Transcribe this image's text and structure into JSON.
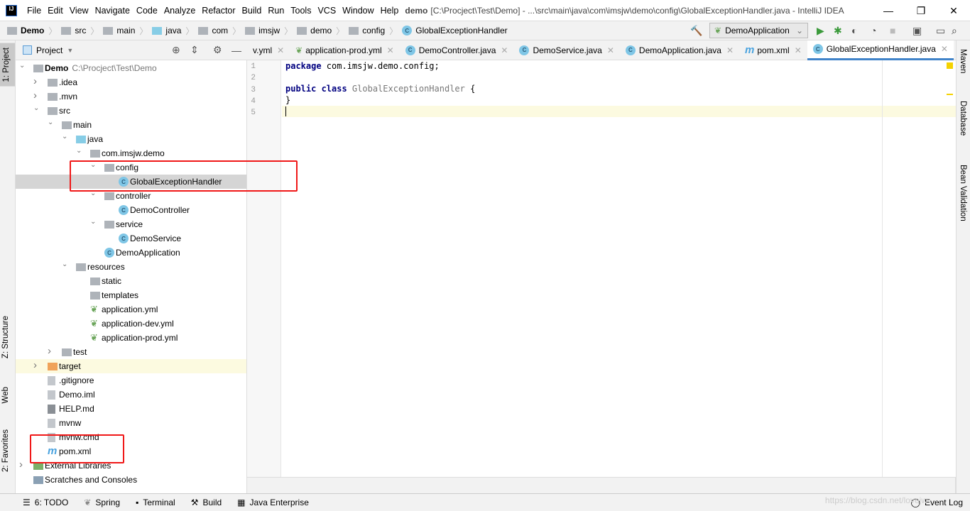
{
  "title_bar": {
    "menu": [
      "File",
      "Edit",
      "View",
      "Navigate",
      "Code",
      "Analyze",
      "Refactor",
      "Build",
      "Run",
      "Tools",
      "VCS",
      "Window",
      "Help"
    ],
    "project": "demo",
    "title": "[C:\\Procject\\Test\\Demo] - ...\\src\\main\\java\\com\\imsjw\\demo\\config\\GlobalExceptionHandler.java - IntelliJ IDEA"
  },
  "breadcrumb": [
    "Demo",
    "src",
    "main",
    "java",
    "com",
    "imsjw",
    "demo",
    "config",
    "GlobalExceptionHandler"
  ],
  "run_config": "DemoApplication",
  "project_panel": {
    "title": "Project"
  },
  "tree": [
    {
      "label": "Demo",
      "path": "C:\\Procject\\Test\\Demo",
      "level": 0,
      "arrow": "down",
      "icon": "module-folder"
    },
    {
      "label": ".idea",
      "level": 1,
      "arrow": "right",
      "icon": "folder"
    },
    {
      "label": ".mvn",
      "level": 1,
      "arrow": "right",
      "icon": "folder"
    },
    {
      "label": "src",
      "level": 1,
      "arrow": "down",
      "icon": "folder"
    },
    {
      "label": "main",
      "level": 2,
      "arrow": "down",
      "icon": "folder"
    },
    {
      "label": "java",
      "level": 3,
      "arrow": "down",
      "icon": "source-folder"
    },
    {
      "label": "com.imsjw.demo",
      "level": 4,
      "arrow": "down",
      "icon": "package"
    },
    {
      "label": "config",
      "level": 5,
      "arrow": "down",
      "icon": "package"
    },
    {
      "label": "GlobalExceptionHandler",
      "level": 6,
      "icon": "class",
      "selected": true
    },
    {
      "label": "controller",
      "level": 5,
      "arrow": "down",
      "icon": "package"
    },
    {
      "label": "DemoController",
      "level": 6,
      "icon": "class"
    },
    {
      "label": "service",
      "level": 5,
      "arrow": "down",
      "icon": "package"
    },
    {
      "label": "DemoService",
      "level": 6,
      "icon": "class"
    },
    {
      "label": "DemoApplication",
      "level": 5,
      "icon": "spring-class"
    },
    {
      "label": "resources",
      "level": 3,
      "arrow": "down",
      "icon": "resources-folder"
    },
    {
      "label": "static",
      "level": 4,
      "icon": "folder"
    },
    {
      "label": "templates",
      "level": 4,
      "icon": "folder"
    },
    {
      "label": "application.yml",
      "level": 4,
      "icon": "spring-yml"
    },
    {
      "label": "application-dev.yml",
      "level": 4,
      "icon": "spring-yml"
    },
    {
      "label": "application-prod.yml",
      "level": 4,
      "icon": "spring-yml"
    },
    {
      "label": "test",
      "level": 2,
      "arrow": "right",
      "icon": "folder"
    },
    {
      "label": "target",
      "level": 1,
      "arrow": "right",
      "icon": "excluded-folder",
      "highlight": true
    },
    {
      "label": ".gitignore",
      "level": 1,
      "icon": "file"
    },
    {
      "label": "Demo.iml",
      "level": 1,
      "icon": "file"
    },
    {
      "label": "HELP.md",
      "level": 1,
      "icon": "markdown"
    },
    {
      "label": "mvnw",
      "level": 1,
      "icon": "file"
    },
    {
      "label": "mvnw.cmd",
      "level": 1,
      "icon": "file"
    },
    {
      "label": "pom.xml",
      "level": 1,
      "icon": "maven"
    },
    {
      "label": "External Libraries",
      "level": 0,
      "arrow": "right",
      "icon": "libraries"
    },
    {
      "label": "Scratches and Consoles",
      "level": 0,
      "icon": "scratches"
    }
  ],
  "tabs": [
    {
      "label": "v.yml",
      "icon": "none"
    },
    {
      "label": "application-prod.yml",
      "icon": "spring-yml"
    },
    {
      "label": "DemoController.java",
      "icon": "class"
    },
    {
      "label": "DemoService.java",
      "icon": "class"
    },
    {
      "label": "DemoApplication.java",
      "icon": "spring-class"
    },
    {
      "label": "pom.xml",
      "icon": "maven"
    },
    {
      "label": "GlobalExceptionHandler.java",
      "icon": "class",
      "active": true
    }
  ],
  "tab_overflow": "2",
  "code": {
    "line_numbers": [
      "1",
      "2",
      "3",
      "4",
      "5"
    ],
    "line1_kw": "package",
    "line1_rest": " com.imsjw.demo.config;",
    "line3_kw": "public class",
    "line3_name": " GlobalExceptionHandler",
    "line3_brace": " {",
    "line4": "}"
  },
  "left_tool_tabs": [
    "1: Project",
    "Z: Structure",
    "Web",
    "2: Favorites"
  ],
  "right_tool_tabs": [
    "Maven",
    "Database",
    "Bean Validation"
  ],
  "bottom_tabs": [
    "6: TODO",
    "Spring",
    "Terminal",
    "Build",
    "Java Enterprise"
  ],
  "event_log": "Event Log",
  "watermark": "https://blog.csdn.net/lovejw",
  "colors": {
    "accent": "#4083c9",
    "selection": "#d5d5d5",
    "annotation": "#f01818",
    "current_line": "#fcfae0"
  }
}
